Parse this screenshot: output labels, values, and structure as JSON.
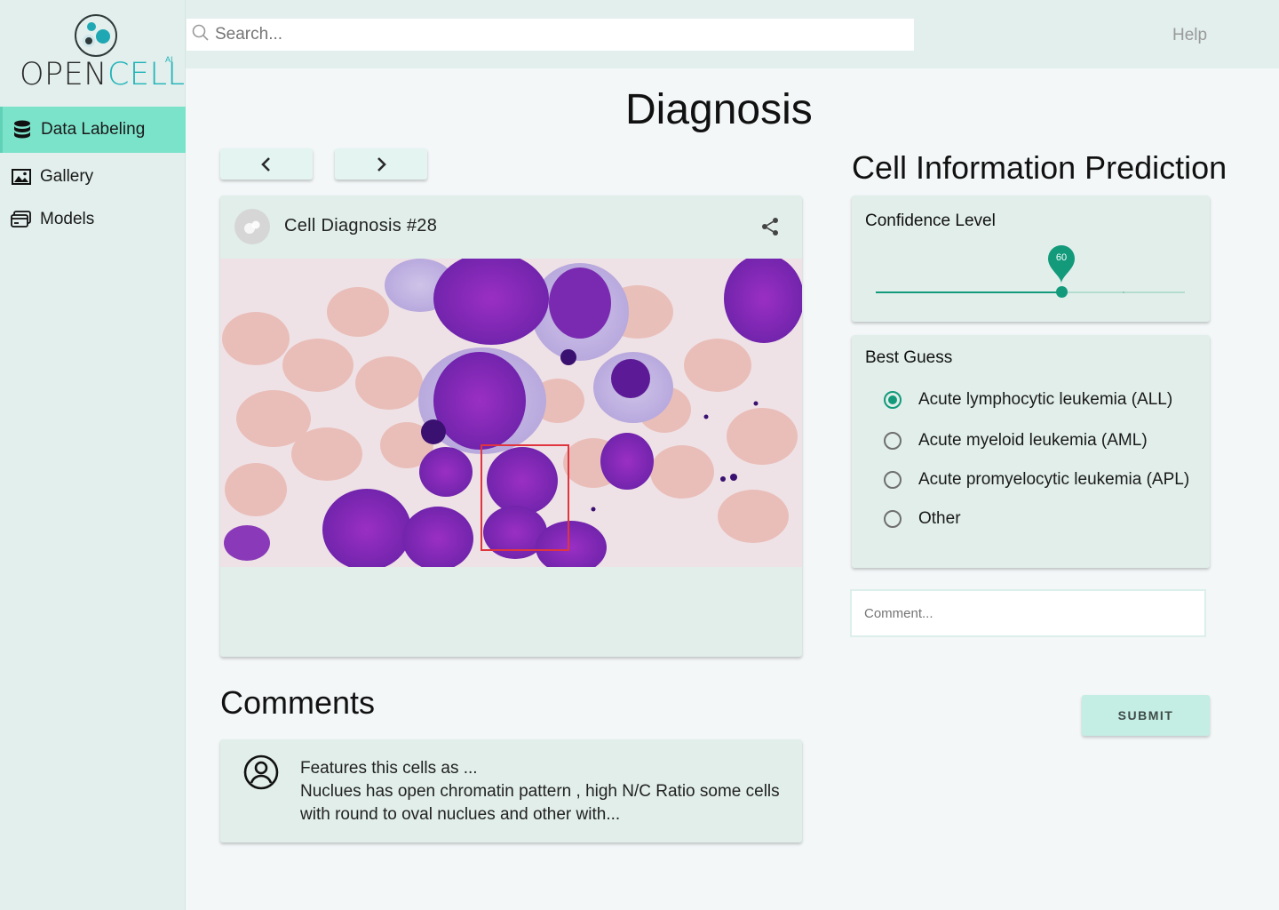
{
  "brand": {
    "name_part1": "OPEN",
    "name_part2": "CELL",
    "suffix": "AI"
  },
  "sidebar": {
    "items": [
      {
        "label": "Data Labeling",
        "icon": "database-icon",
        "active": true
      },
      {
        "label": "Gallery",
        "icon": "image-icon",
        "active": false
      },
      {
        "label": "Models",
        "icon": "cards-icon",
        "active": false
      }
    ]
  },
  "header": {
    "search_placeholder": "Search...",
    "help_label": "Help"
  },
  "page": {
    "title": "Diagnosis"
  },
  "card": {
    "title": "Cell Diagnosis #28"
  },
  "comments": {
    "title": "Comments",
    "items": [
      {
        "line1": "Features this cells as ...",
        "line2": "Nuclues has open chromatin pattern , high N/C Ratio some cells with round to oval nuclues and other with..."
      }
    ]
  },
  "prediction": {
    "title": "Cell Information Prediction",
    "confidence": {
      "label": "Confidence Level",
      "value": 60,
      "min": 0,
      "max": 100,
      "steps": 5
    },
    "best_guess": {
      "label": "Best Guess",
      "options": [
        "Acute lymphocytic leukemia (ALL)",
        "Acute myeloid leukemia (AML)",
        "Acute promyelocytic leukemia (APL)",
        "Other"
      ],
      "selected_index": 0
    },
    "comment_placeholder": "Comment...",
    "submit_label": "SUBMIT"
  },
  "colors": {
    "accent": "#129a7b",
    "sidebar_bg": "#e2efec",
    "active_nav": "#7ce3cb",
    "logo_teal": "#1fb2b8"
  }
}
